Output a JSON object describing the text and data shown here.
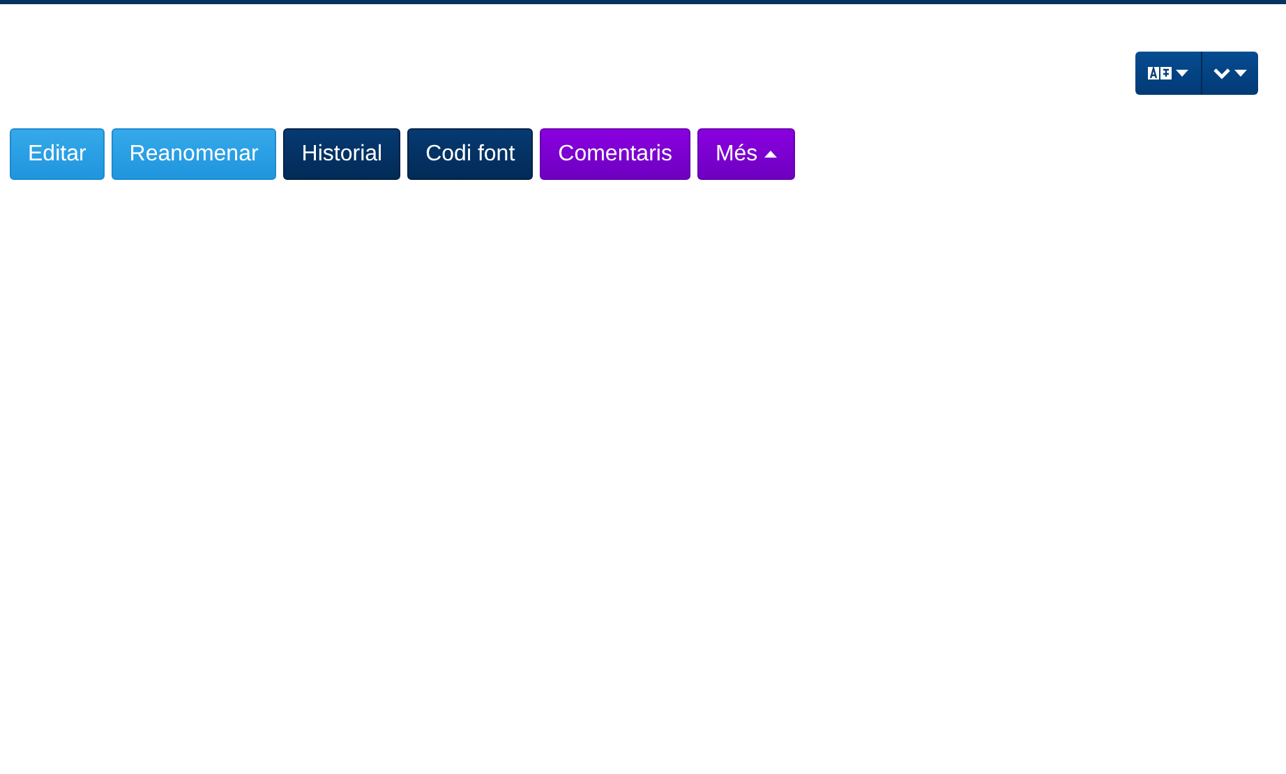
{
  "toolbar_buttons": [
    {
      "label": "Editar",
      "kind": "light"
    },
    {
      "label": "Reanomenar",
      "kind": "light"
    },
    {
      "label": "Historial",
      "kind": "dark"
    },
    {
      "label": "Codi font",
      "kind": "dark"
    },
    {
      "label": "Comentaris",
      "kind": "purple"
    },
    {
      "label": "Més",
      "kind": "purple",
      "menu": true
    }
  ]
}
